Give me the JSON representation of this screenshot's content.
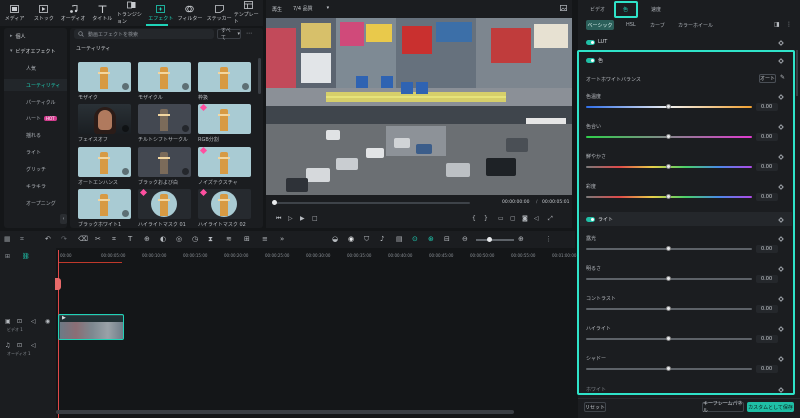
{
  "toolbar": {
    "items": [
      {
        "label": "メディア",
        "icon": "media-icon"
      },
      {
        "label": "ストック",
        "icon": "stock-icon"
      },
      {
        "label": "オーディオ",
        "icon": "audio-icon"
      },
      {
        "label": "タイトル",
        "icon": "title-icon"
      },
      {
        "label": "トランジション",
        "icon": "transition-icon"
      },
      {
        "label": "エフェクト",
        "icon": "effects-icon"
      },
      {
        "label": "フィルター",
        "icon": "filter-icon"
      },
      {
        "label": "ステッカー",
        "icon": "sticker-icon"
      },
      {
        "label": "テンプレート",
        "icon": "template-icon"
      }
    ],
    "active": "エフェクト"
  },
  "left_nav": {
    "items": [
      {
        "label": "個人",
        "type": "header"
      },
      {
        "label": "ビデオエフェクト",
        "type": "header"
      },
      {
        "label": "人気",
        "type": "item"
      },
      {
        "label": "ユーティリティ",
        "type": "active"
      },
      {
        "label": "パーティクル",
        "type": "item"
      },
      {
        "label": "ハート",
        "type": "item",
        "badge": "HOT"
      },
      {
        "label": "揺れる",
        "type": "item"
      },
      {
        "label": "ライト",
        "type": "item"
      },
      {
        "label": "グリッチ",
        "type": "item"
      },
      {
        "label": "キラキラ",
        "type": "item"
      },
      {
        "label": "オープニング",
        "type": "item"
      }
    ]
  },
  "browser": {
    "search_placeholder": "動画エフェクトを検索",
    "sort_label": "すべて",
    "category_title": "ユーティリティ",
    "thumbs": [
      {
        "label": "モザイク",
        "style": "tower"
      },
      {
        "label": "モザイクル",
        "style": "tower"
      },
      {
        "label": "枠扱",
        "style": "tower"
      },
      {
        "label": "フェイスオフ",
        "style": "person"
      },
      {
        "label": "チルトシフトサークル",
        "style": "dark"
      },
      {
        "label": "RGB分割",
        "style": "tower",
        "gem": true
      },
      {
        "label": "オートエンハンス",
        "style": "tower"
      },
      {
        "label": "ブラックおよび白",
        "style": "dark"
      },
      {
        "label": "ノイズテクスチャ",
        "style": "tower",
        "gem": true
      },
      {
        "label": "ブラックホワイト1",
        "style": "tower"
      },
      {
        "label": "ハイライトマスク 01",
        "style": "circle",
        "gem": true
      },
      {
        "label": "ハイライトマスク 02",
        "style": "circle",
        "gem": true
      }
    ]
  },
  "preview": {
    "player_label": "再生",
    "quality_label": "7/4 品質",
    "time_current": "00:00:00:00",
    "time_separator": "/",
    "time_total": "00:00:05:01"
  },
  "right_panel": {
    "tabs": [
      "ビデオ",
      "色",
      "速度"
    ],
    "active_tab": "色",
    "subtabs": [
      "ベーシック",
      "HSL",
      "カーブ",
      "カラーホイール"
    ],
    "active_subtab": "ベーシック",
    "lut_label": "LUT",
    "color_section": "色",
    "auto_white_balance_label": "オートホワイトバランス",
    "auto_button": "オート",
    "color_sliders": [
      {
        "label": "色温度",
        "value": "0.00"
      },
      {
        "label": "色合い",
        "value": "0.00"
      },
      {
        "label": "鮮やかさ",
        "value": "0.00"
      },
      {
        "label": "彩度",
        "value": "0.00"
      }
    ],
    "light_section": "ライト",
    "light_sliders": [
      {
        "label": "露光",
        "value": "0.00"
      },
      {
        "label": "明るさ",
        "value": "0.00"
      },
      {
        "label": "コントラスト",
        "value": "0.00"
      },
      {
        "label": "ハイライト",
        "value": "0.00"
      },
      {
        "label": "シャドー",
        "value": "0.00"
      }
    ],
    "last_row_label": "ホワイト",
    "reset_button": "リセット",
    "keyframe_button": "キーフレームパネル",
    "custom_save_button": "カスタムとして保存"
  },
  "timeline": {
    "ruler_ticks": [
      "00:00",
      "00:00:05:00",
      "00:00:10:00",
      "00:00:15:00",
      "00:00:20:00",
      "00:00:25:00",
      "00:00:30:00",
      "00:00:35:00",
      "00:00:40:00",
      "00:00:45:00",
      "00:00:50:00",
      "00:00:55:00",
      "00:01:00:00"
    ],
    "video_track_label": "ビデオ 1",
    "audio_track_label": "オーディオ 1"
  },
  "colors": {
    "accent": "#1fd3b8",
    "highlight_border": "#2fe3c9"
  }
}
